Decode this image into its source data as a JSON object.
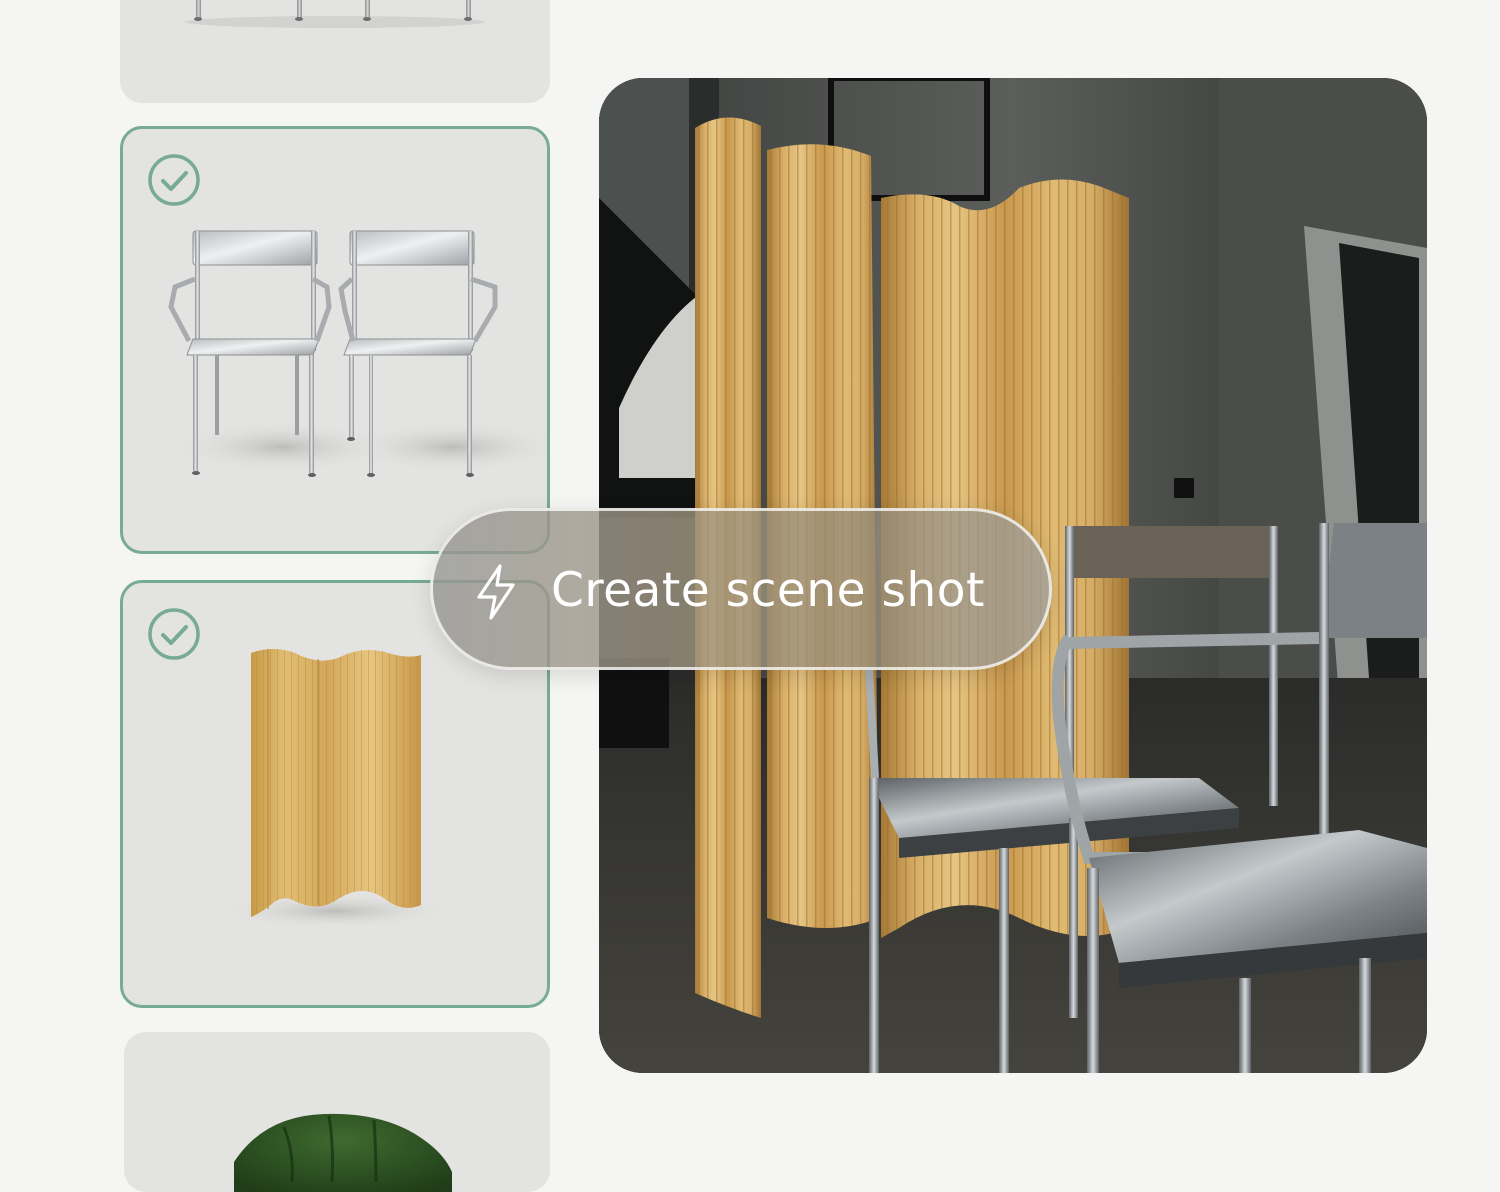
{
  "cta": {
    "label": "Create scene shot",
    "icon": "lightning-bolt-icon"
  },
  "product_cards": [
    {
      "product": "dining chairs (top, partially visible)",
      "selected": false
    },
    {
      "product": "pair of aluminium armchairs",
      "selected": true
    },
    {
      "product": "wooden folding screen",
      "selected": true
    },
    {
      "product": "green velvet chair (bottom, partially visible)",
      "selected": false
    }
  ],
  "colors": {
    "page_background": "#f5f5f3",
    "card_background": "#e3e3e1",
    "selected_accent": "#78aa98",
    "cta_text": "#ffffff"
  }
}
